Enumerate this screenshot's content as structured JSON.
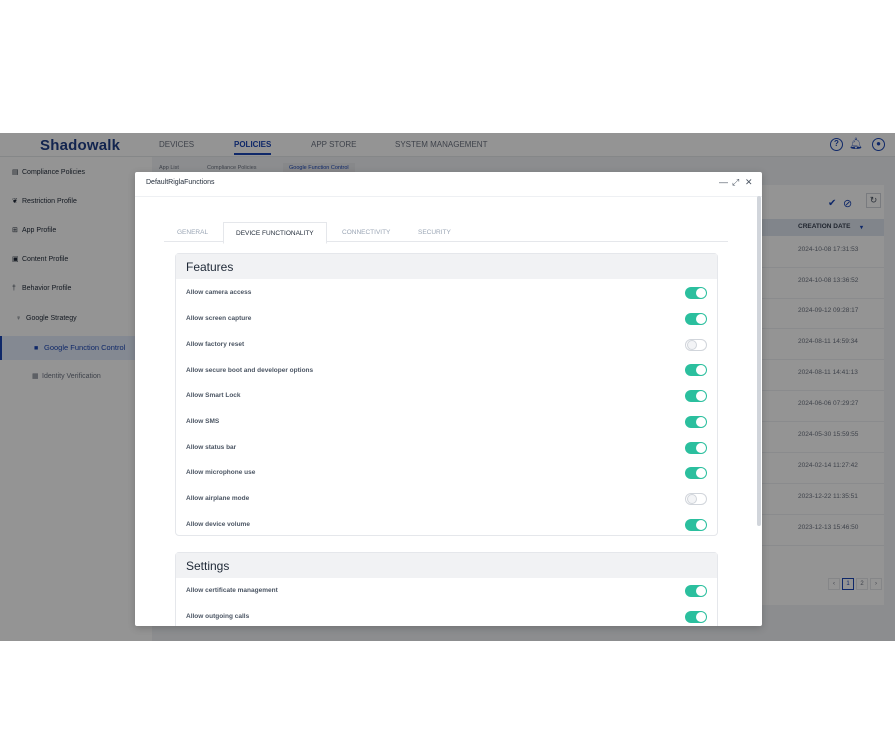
{
  "app": {
    "logo": "Shadowalk",
    "nav": [
      "DEVICES",
      "POLICIES",
      "APP STORE",
      "SYSTEM MANAGEMENT"
    ],
    "active_nav": "POLICIES"
  },
  "sidebar": {
    "items": [
      {
        "label": "Compliance Policies"
      },
      {
        "label": "Restriction Profile"
      },
      {
        "label": "App Profile"
      },
      {
        "label": "Content Profile"
      },
      {
        "label": "Behavior Profile"
      },
      {
        "label": "Google Strategy"
      },
      {
        "label": "Google Function Control"
      },
      {
        "label": "Identity Verification"
      }
    ]
  },
  "subtabs": [
    "App List",
    "Compliance Policies",
    "Google Function Control"
  ],
  "right_panel": {
    "column_header": "CREATION DATE",
    "dates": [
      "2024-10-08 17:31:53",
      "2024-10-08 13:36:52",
      "2024-09-12 09:28:17",
      "2024-08-11 14:59:34",
      "2024-08-11 14:41:13",
      "2024-06-06 07:29:27",
      "2024-05-30 15:59:55",
      "2024-02-14 11:27:42",
      "2023-12-22 11:35:51",
      "2023-12-13 15:46:50"
    ],
    "pages": [
      "‹",
      "1",
      "2",
      "›"
    ]
  },
  "modal": {
    "title": "DefaultRiglaFunctions",
    "controls": {
      "minimize": "—",
      "maximize": "⤢",
      "close": "✕"
    },
    "tabs": [
      "GENERAL",
      "DEVICE FUNCTIONALITY",
      "CONNECTIVITY",
      "SECURITY"
    ],
    "active_tab": "DEVICE FUNCTIONALITY",
    "features": {
      "title": "Features",
      "rows": [
        {
          "label": "Allow camera access",
          "on": true
        },
        {
          "label": "Allow screen capture",
          "on": true
        },
        {
          "label": "Allow factory reset",
          "on": false
        },
        {
          "label": "Allow secure boot and developer options",
          "on": true
        },
        {
          "label": "Allow Smart Lock",
          "on": true
        },
        {
          "label": "Allow SMS",
          "on": true
        },
        {
          "label": "Allow status bar",
          "on": true
        },
        {
          "label": "Allow microphone use",
          "on": true
        },
        {
          "label": "Allow airplane mode",
          "on": false
        },
        {
          "label": "Allow device volume",
          "on": true
        }
      ]
    },
    "settings": {
      "title": "Settings",
      "rows": [
        {
          "label": "Allow certificate management",
          "on": true
        },
        {
          "label": "Allow outgoing calls",
          "on": true
        }
      ]
    }
  },
  "colors": {
    "accent": "#1b46b5",
    "toggle_on": "#2bbf9e"
  }
}
